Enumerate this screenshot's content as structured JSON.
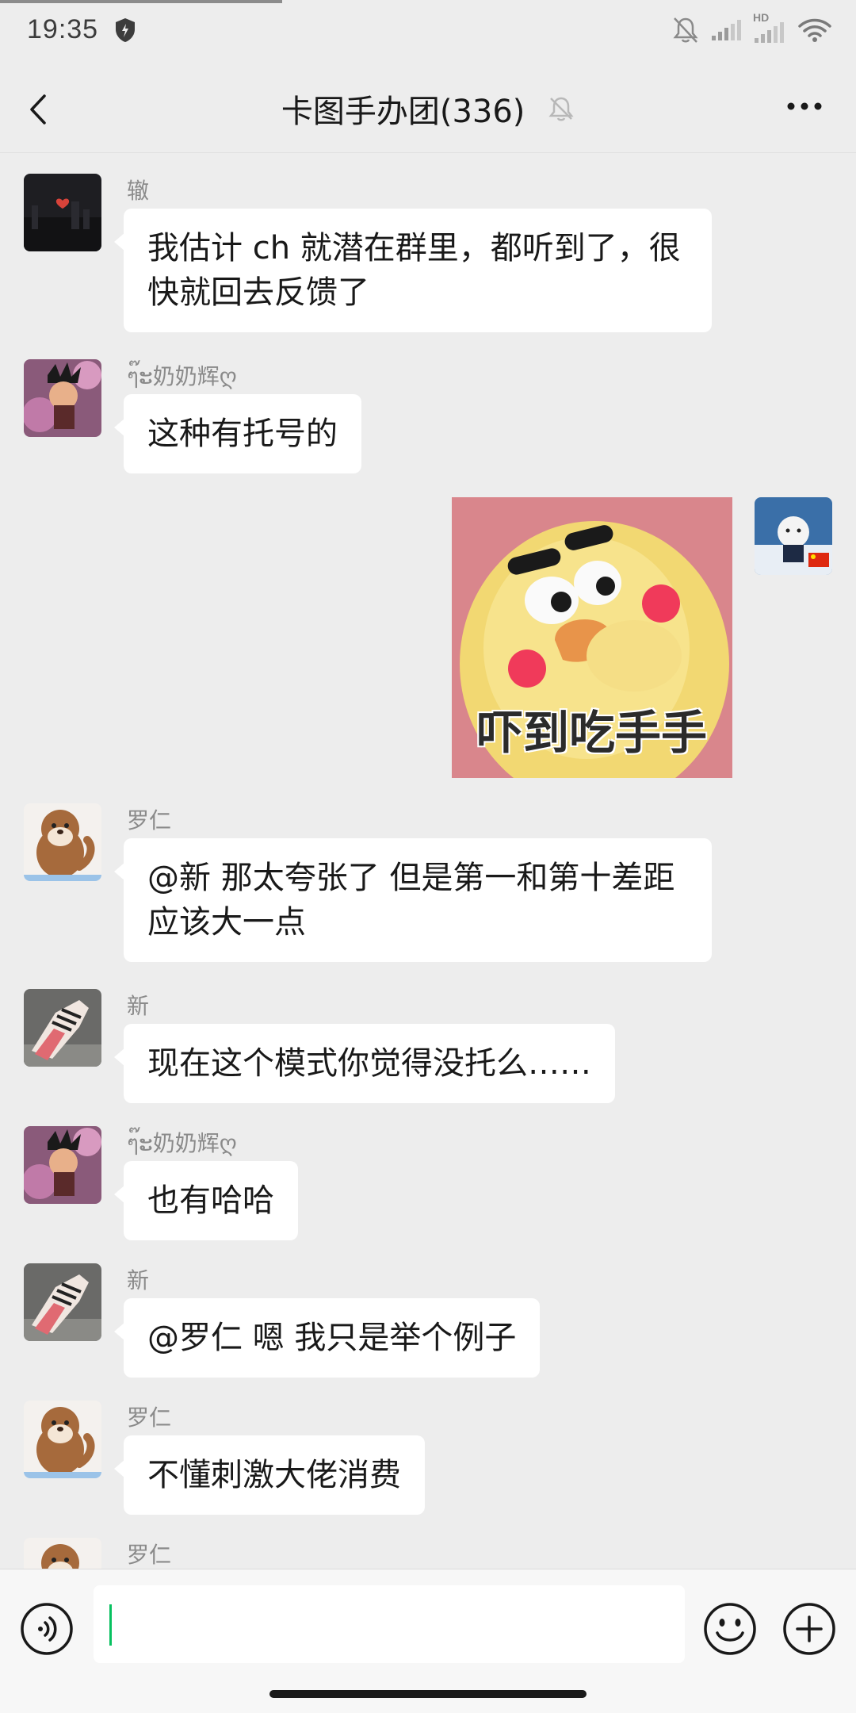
{
  "status_bar": {
    "time": "19:35",
    "network_badge": "HD",
    "icons": [
      "shield-icon",
      "bell-muted-icon",
      "signal-icon",
      "wifi-icon"
    ]
  },
  "header": {
    "title": "卡图手办团(336)",
    "back_icon": "chevron-left-icon",
    "mute_icon": "bell-muted-icon",
    "more_icon": "ellipsis-icon"
  },
  "messages": [
    {
      "sender": "辙",
      "text_lines": [
        "我估计 ch 就潜在群里，都听到了，很",
        "快就回去反馈了"
      ]
    },
    {
      "sender": "ๆ๊ະ奶奶辉ღ",
      "text_lines": [
        "这种有托号的"
      ]
    },
    {
      "sender": "",
      "sticker_caption": "吓到吃手手",
      "self": true
    },
    {
      "sender": "罗仁",
      "text_lines": [
        "@新  那太夸张了 但是第一和第十差距",
        "应该大一点"
      ]
    },
    {
      "sender": "新",
      "text_lines": [
        "现在这个模式你觉得没托么……"
      ]
    },
    {
      "sender": "ๆ๊ະ奶奶辉ღ",
      "text_lines": [
        "也有哈哈"
      ]
    },
    {
      "sender": "新",
      "text_lines": [
        "@罗仁  嗯 我只是举个例子"
      ]
    },
    {
      "sender": "罗仁",
      "text_lines": [
        "不懂刺激大佬消费"
      ]
    },
    {
      "sender": "罗仁",
      "text_lines": []
    }
  ],
  "input_bar": {
    "value": "",
    "voice_icon": "voice-icon",
    "emoji_icon": "emoji-icon",
    "plus_icon": "plus-icon"
  },
  "colors": {
    "background": "#ededed",
    "bubble": "#ffffff",
    "caret": "#07c160",
    "sender_name": "#8a8a8a"
  }
}
